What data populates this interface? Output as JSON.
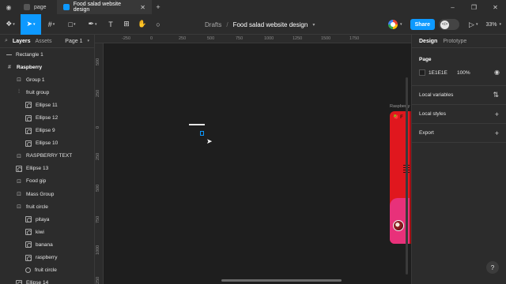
{
  "browser": {
    "tabs": [
      {
        "label": "page"
      },
      {
        "label": "Food salad website design"
      }
    ],
    "add_tab": "+",
    "window_controls": [
      "–",
      "❐",
      "✕"
    ]
  },
  "toolbar": {
    "icons": [
      "figma-menu-icon",
      "move-tool-icon",
      "frame-tool-icon",
      "shape-tool-icon",
      "pen-tool-icon",
      "text-tool-icon",
      "resources-icon",
      "hand-tool-icon",
      "comment-icon"
    ],
    "breadcrumb": {
      "drafts": "Drafts",
      "separator": "/",
      "file": "Food salad website design"
    },
    "share_label": "Share",
    "zoom": "33%"
  },
  "layers_panel": {
    "tab_layers": "Layers",
    "tab_assets": "Assets",
    "page": "Page 1",
    "items": [
      {
        "label": "Rectangle 1",
        "icon": "line-icon",
        "level": 0,
        "bold": false
      },
      {
        "label": "Raspberry",
        "icon": "frame-icon",
        "level": 0,
        "bold": true
      },
      {
        "label": "Group 1",
        "icon": "group-icon",
        "level": 1,
        "bold": false
      },
      {
        "label": "fruit group",
        "icon": "autolayout-icon",
        "level": 1,
        "bold": false
      },
      {
        "label": "Ellipse 11",
        "icon": "image-ellipse-icon",
        "level": 2,
        "bold": false
      },
      {
        "label": "Ellipse 12",
        "icon": "image-ellipse-icon",
        "level": 2,
        "bold": false
      },
      {
        "label": "Ellipse 9",
        "icon": "image-ellipse-icon",
        "level": 2,
        "bold": false
      },
      {
        "label": "Ellipse 10",
        "icon": "image-ellipse-icon",
        "level": 2,
        "bold": false
      },
      {
        "label": "RASPBERRY TEXT",
        "icon": "group-icon",
        "level": 1,
        "bold": false
      },
      {
        "label": "Ellipse 13",
        "icon": "image-ellipse-icon",
        "level": 1,
        "bold": false
      },
      {
        "label": "Food gip",
        "icon": "group-icon",
        "level": 1,
        "bold": false
      },
      {
        "label": "Mass Group",
        "icon": "group-icon",
        "level": 1,
        "bold": false
      },
      {
        "label": "fruit circle",
        "icon": "group-icon",
        "level": 1,
        "bold": false
      },
      {
        "label": "pitaya",
        "icon": "image-ellipse-icon",
        "level": 2,
        "bold": false
      },
      {
        "label": "kiwi",
        "icon": "image-ellipse-icon",
        "level": 2,
        "bold": false
      },
      {
        "label": "banana",
        "icon": "image-ellipse-icon",
        "level": 2,
        "bold": false
      },
      {
        "label": "raspberry",
        "icon": "image-ellipse-icon",
        "level": 2,
        "bold": false
      },
      {
        "label": "fruit circle",
        "icon": "circle-icon",
        "level": 2,
        "bold": false
      },
      {
        "label": "Ellipse 14",
        "icon": "image-ellipse-icon",
        "level": 1,
        "bold": false
      }
    ]
  },
  "canvas": {
    "ruler_top": [
      "-250",
      "0",
      "250",
      "500",
      "750",
      "1000",
      "1250",
      "1500",
      "1750"
    ],
    "ruler_left": [
      "500",
      "250",
      "0",
      "250",
      "500",
      "750",
      "1000",
      "1250"
    ],
    "frame_label": "Raspberry",
    "frame_logo": "🍓 F"
  },
  "design_panel": {
    "tab_design": "Design",
    "tab_prototype": "Prototype",
    "page_title": "Page",
    "page_color": "1E1E1E",
    "page_opacity": "100%",
    "sections": [
      {
        "label": "Local variables",
        "action": "⇅"
      },
      {
        "label": "Local styles",
        "action": "+"
      },
      {
        "label": "Export",
        "action": "+"
      }
    ],
    "help": "?"
  }
}
